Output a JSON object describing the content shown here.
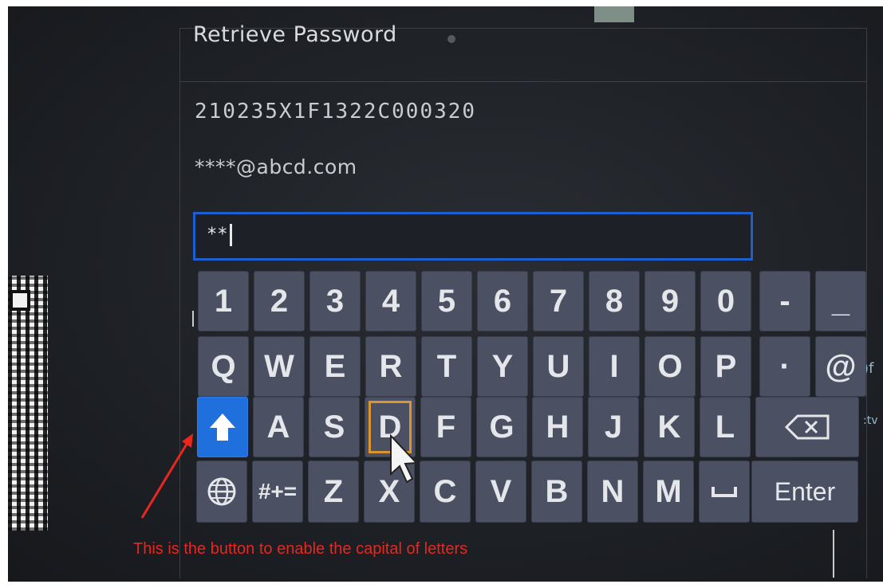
{
  "dialog": {
    "title": "Retrieve Password",
    "serial": "210235X1F1322C000320",
    "email": "****@abcd.com",
    "password_input": {
      "value": "**"
    }
  },
  "edge_text": {
    "right_top": ")f",
    "right_bottom": ":tv"
  },
  "keyboard": {
    "rows": [
      [
        "1",
        "2",
        "3",
        "4",
        "5",
        "6",
        "7",
        "8",
        "9",
        "0",
        "-",
        "_"
      ],
      [
        "Q",
        "W",
        "E",
        "R",
        "T",
        "Y",
        "U",
        "I",
        "O",
        "P",
        "·",
        "@"
      ],
      [
        "shift-icon",
        "A",
        "S",
        "D",
        "F",
        "G",
        "H",
        "J",
        "K",
        "L",
        "backspace-icon"
      ],
      [
        "globe-icon",
        "#+=",
        "Z",
        "X",
        "C",
        "V",
        "B",
        "N",
        "M",
        "space-icon",
        "Enter"
      ]
    ],
    "focused_key": "D",
    "shift_key_active": true,
    "colors": {
      "key": "#4b5062",
      "shift_key": "#1f6fdd",
      "focus_outline": "#d9962e",
      "input_border": "#1e5fd0"
    }
  },
  "annotation": {
    "text": "This is the button to enable the capital of letters",
    "color": "#e8271e"
  }
}
